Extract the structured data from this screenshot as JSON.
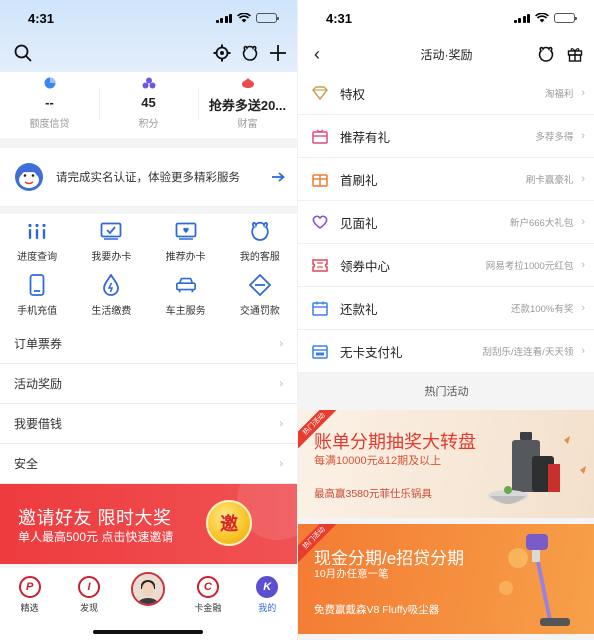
{
  "left": {
    "status": {
      "time": "4:31"
    },
    "stats": [
      {
        "value": "--",
        "label": "额度信贷"
      },
      {
        "value": "45",
        "label": "积分"
      },
      {
        "value": "抢券多送20...",
        "label": "财富"
      }
    ],
    "verify": {
      "text": "请完成实名认证，体验更多精彩服务"
    },
    "grid": [
      {
        "label": "进度查询",
        "icon": "progress-icon"
      },
      {
        "label": "我要办卡",
        "icon": "card-icon"
      },
      {
        "label": "推荐办卡",
        "icon": "recommend-card-icon"
      },
      {
        "label": "我的客服",
        "icon": "service-icon"
      },
      {
        "label": "手机充值",
        "icon": "phone-icon"
      },
      {
        "label": "生活缴费",
        "icon": "water-drop-icon"
      },
      {
        "label": "车主服务",
        "icon": "car-icon"
      },
      {
        "label": "交通罚款",
        "icon": "traffic-icon"
      }
    ],
    "rows": [
      {
        "label": "订单票券"
      },
      {
        "label": "活动奖励"
      },
      {
        "label": "我要借钱"
      },
      {
        "label": "安全"
      }
    ],
    "banner": {
      "title": "邀请好友 限时大奖",
      "subtitle": "单人最高500元 点击快速邀请",
      "coin": "邀"
    },
    "tabs": [
      {
        "label": "精选",
        "letter": "P"
      },
      {
        "label": "发现",
        "letter": "I"
      },
      {
        "label": "",
        "letter": ""
      },
      {
        "label": "卡金融",
        "letter": "C"
      },
      {
        "label": "我的",
        "letter": "K"
      }
    ]
  },
  "right": {
    "status": {
      "time": "4:31"
    },
    "title": "活动·奖励",
    "items": [
      {
        "label": "特权",
        "sub": "淘福利",
        "color": "#c9a04d"
      },
      {
        "label": "推荐有礼",
        "sub": "多荐多得",
        "color": "#e24a7c"
      },
      {
        "label": "首刷礼",
        "sub": "刷卡赢豪礼",
        "color": "#f07a2c"
      },
      {
        "label": "见面礼",
        "sub": "新户666大礼包",
        "color": "#8a4fd8"
      },
      {
        "label": "领券中心",
        "sub": "网易考拉1000元红包",
        "color": "#e2455a"
      },
      {
        "label": "还款礼",
        "sub": "还款100%有奖",
        "color": "#3b7ee8"
      },
      {
        "label": "无卡支付礼",
        "sub": "刮刮乐/连连看/天天领",
        "color": "#3b7ee8"
      }
    ],
    "hot_title": "热门活动",
    "cards": [
      {
        "tag": "热门活动",
        "title": "账单分期抽奖大转盘",
        "line2": "每满10000元&12期及以上",
        "line3": "最高赢3580元菲仕乐锅具"
      },
      {
        "tag": "热门活动",
        "title": "现金分期/e招贷分期",
        "line2": "10月办任意一笔",
        "line3": "免费赢戴森V8 Fluffy吸尘器"
      }
    ]
  }
}
